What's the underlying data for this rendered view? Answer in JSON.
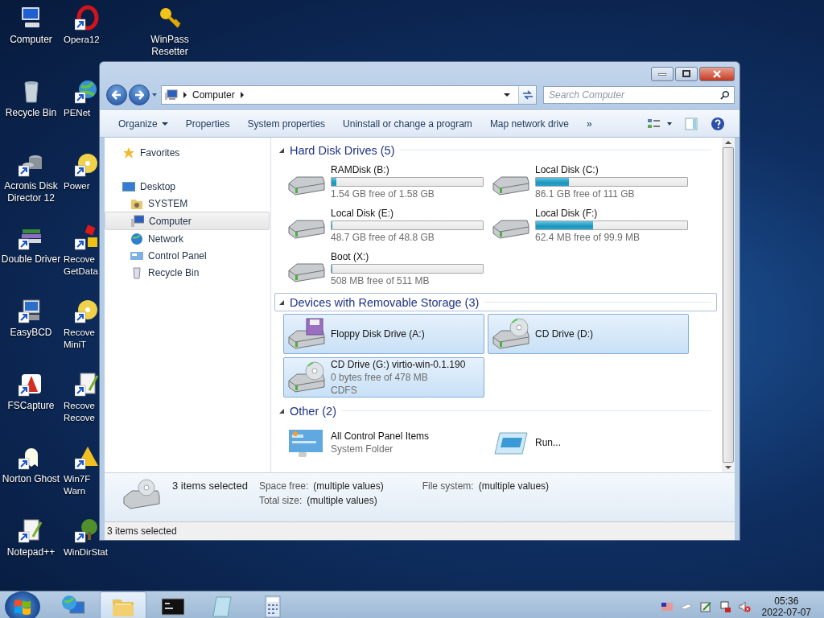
{
  "desktop": {
    "columns": [
      [
        {
          "lines": [
            "Computer"
          ],
          "kind": "computer",
          "shortcut": false
        },
        {
          "lines": [
            "Recycle Bin"
          ],
          "kind": "recycle-bin",
          "shortcut": false
        },
        {
          "lines": [
            "Acronis Disk",
            "Director 12"
          ],
          "kind": "disks",
          "shortcut": true
        },
        {
          "lines": [
            "Double Driver"
          ],
          "kind": "books",
          "shortcut": true
        },
        {
          "lines": [
            "EasyBCD"
          ],
          "kind": "monitor",
          "shortcut": true
        },
        {
          "lines": [
            "FSCapture"
          ],
          "kind": "capture",
          "shortcut": true
        },
        {
          "lines": [
            "Norton Ghost"
          ],
          "kind": "ghost",
          "shortcut": true
        },
        {
          "lines": [
            "Notepad++"
          ],
          "kind": "notepad",
          "shortcut": true
        }
      ],
      [
        {
          "lines": [
            "Opera12"
          ],
          "kind": "opera",
          "shortcut": true
        },
        {
          "lines": [
            "PENet"
          ],
          "kind": "globe",
          "shortcut": true
        },
        {
          "lines": [
            "Power"
          ],
          "kind": "disc",
          "shortcut": true
        },
        {
          "lines": [
            "Recove",
            "GetData"
          ],
          "kind": "blocks",
          "shortcut": true
        },
        {
          "lines": [
            "Recove",
            "MiniT"
          ],
          "kind": "disc",
          "shortcut": true
        },
        {
          "lines": [
            "Recove",
            "Recove"
          ],
          "kind": "document",
          "shortcut": true
        },
        {
          "lines": [
            "Win7F",
            "Warn"
          ],
          "kind": "warning",
          "shortcut": true
        },
        {
          "lines": [
            "WinDirStat"
          ],
          "kind": "tree",
          "shortcut": true
        }
      ],
      [
        {
          "lines": [
            "WinPass",
            "Resetter"
          ],
          "kind": "key",
          "shortcut": false
        }
      ]
    ]
  },
  "window": {
    "address": {
      "crumbs": [
        "Computer"
      ]
    },
    "search": {
      "placeholder": "Search Computer"
    },
    "toolbar": [
      {
        "label": "Organize",
        "dropdown": true
      },
      {
        "label": "Properties",
        "dropdown": false
      },
      {
        "label": "System properties",
        "dropdown": false
      },
      {
        "label": "Uninstall or change a program",
        "dropdown": false
      },
      {
        "label": "Map network drive",
        "dropdown": false
      },
      {
        "label": "»",
        "dropdown": false
      }
    ],
    "nav": {
      "favorites": "Favorites",
      "tree": [
        {
          "label": "Desktop",
          "kind": "desktop",
          "selected": false,
          "children": [
            {
              "label": "SYSTEM",
              "kind": "user-folder",
              "selected": false
            },
            {
              "label": "Computer",
              "kind": "computer",
              "selected": true
            },
            {
              "label": "Network",
              "kind": "globe",
              "selected": false
            },
            {
              "label": "Control Panel",
              "kind": "control-panel",
              "selected": false
            },
            {
              "label": "Recycle Bin",
              "kind": "recycle-bin",
              "selected": false
            }
          ]
        }
      ]
    },
    "groups": [
      {
        "title": "Hard Disk Drives (5)",
        "expanded": true,
        "focused": false,
        "items": [
          {
            "kind": "hdd",
            "name": "RAMDisk (B:)",
            "free": "1.54 GB free of 1.58 GB",
            "level": 0.03,
            "selected": false
          },
          {
            "kind": "hdd",
            "name": "Local Disk (C:)",
            "free": "86.1 GB free of 111 GB",
            "level": 0.22,
            "selected": false
          },
          {
            "kind": "hdd",
            "name": "Local Disk (E:)",
            "free": "48.7 GB free of 48.8 GB",
            "level": 0.005,
            "selected": false
          },
          {
            "kind": "hdd",
            "name": "Local Disk (F:)",
            "free": "62.4 MB free of 99.9 MB",
            "level": 0.38,
            "selected": false
          },
          {
            "kind": "hdd",
            "name": "Boot (X:)",
            "free": "508 MB free of 511 MB",
            "level": 0.006,
            "selected": false
          }
        ]
      },
      {
        "title": "Devices with Removable Storage (3)",
        "expanded": true,
        "focused": true,
        "items": [
          {
            "kind": "floppy",
            "name": "Floppy Disk Drive (A:)",
            "selected": true
          },
          {
            "kind": "cd",
            "name": "CD Drive (D:)",
            "selected": true
          },
          {
            "kind": "cd",
            "name": "CD Drive (G:) virtio-win-0.1.190",
            "details": [
              "0 bytes free of 478 MB",
              "CDFS"
            ],
            "selected": true
          }
        ]
      },
      {
        "title": "Other (2)",
        "expanded": true,
        "focused": false,
        "items": [
          {
            "kind": "control-panel",
            "name": "All Control Panel Items",
            "details": [
              "System Folder"
            ],
            "selected": false
          },
          {
            "kind": "run",
            "name": "Run...",
            "selected": false
          }
        ]
      }
    ],
    "details": {
      "summary": "3 items selected",
      "fields": [
        {
          "label": "Space free:",
          "value": "(multiple values)"
        },
        {
          "label": "Total size:",
          "value": "(multiple values)"
        },
        {
          "label": "File system:",
          "value": "(multiple values)"
        }
      ]
    },
    "status_bar": "3 items selected"
  },
  "taskbar": {
    "apps": [
      {
        "kind": "globe-monitor",
        "active": false
      },
      {
        "kind": "folder",
        "active": true
      },
      {
        "kind": "console",
        "active": false
      },
      {
        "kind": "notepad",
        "active": false
      },
      {
        "kind": "calculator",
        "active": false
      }
    ],
    "time": "05:36",
    "date": "2022-07-07"
  }
}
